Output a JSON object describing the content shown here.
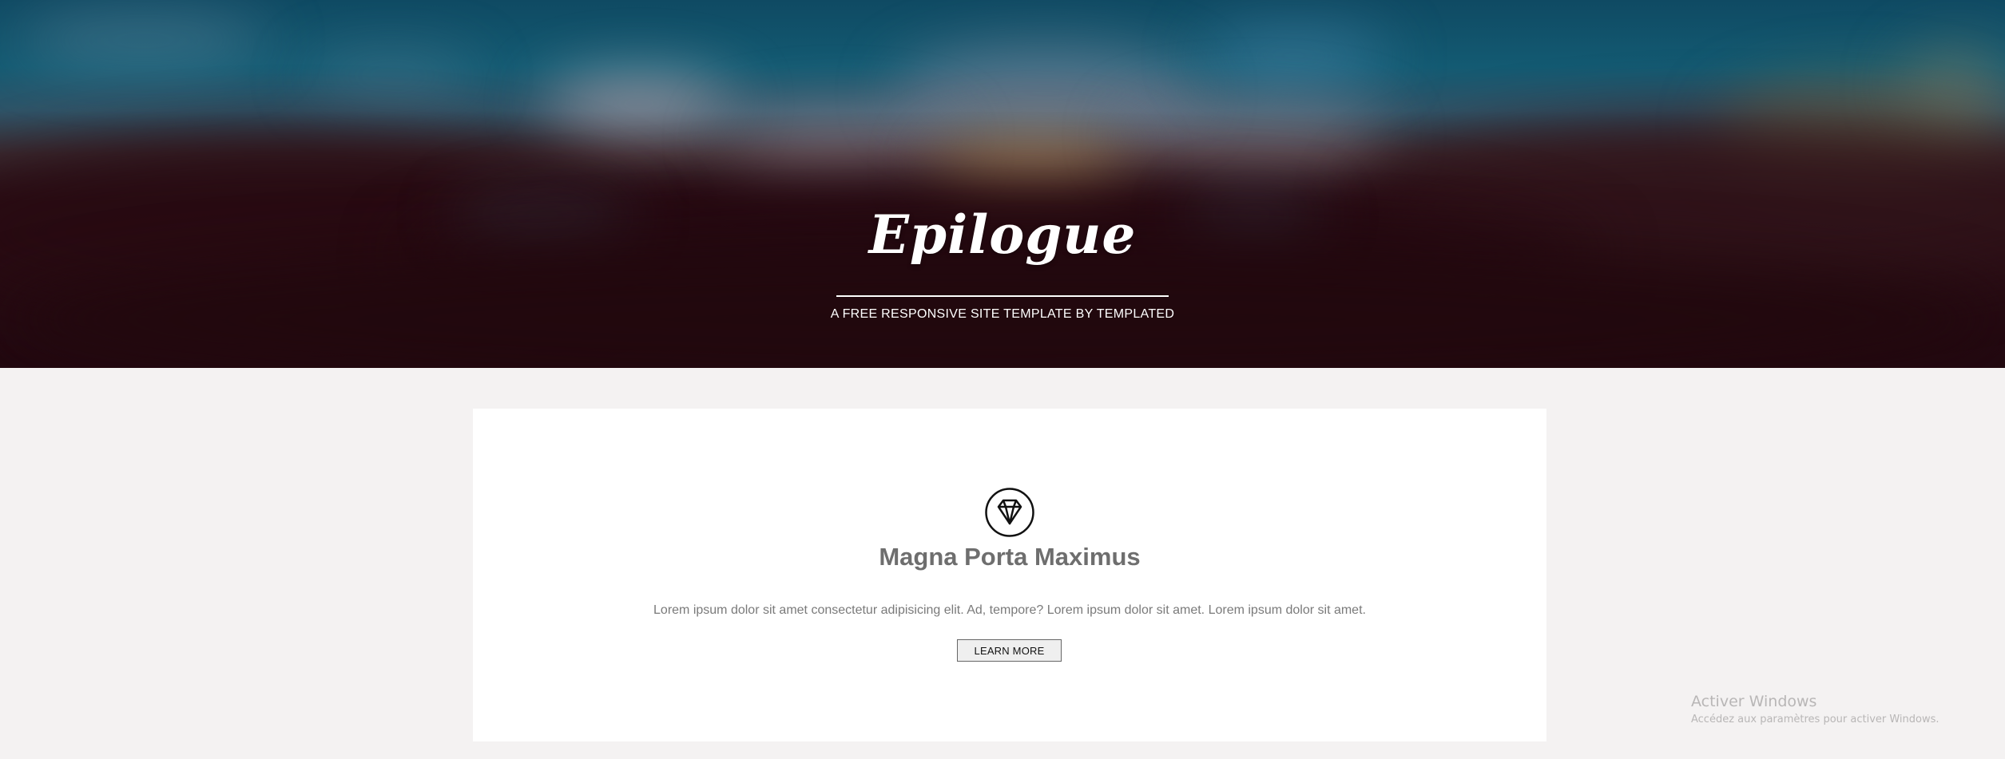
{
  "banner": {
    "brand": "Epilogue",
    "tagline": "A FREE RESPONSIVE SITE TEMPLATE BY TEMPLATED"
  },
  "feature": {
    "icon": "diamond-icon",
    "title": "Magna Porta Maximus",
    "text": "Lorem ipsum dolor sit amet consectetur adipisicing elit. Ad, tempore? Lorem ipsum dolor sit amet. Lorem ipsum dolor sit amet.",
    "button_label": "LEARN MORE"
  },
  "watermark": {
    "title": "Activer Windows",
    "subtitle": "Accédez aux paramètres pour activer Windows."
  },
  "colors": {
    "page_background": "#f4f2f2",
    "card_background": "#ffffff",
    "banner_dark": "#220810",
    "banner_sky": "#135a72",
    "title_gray": "#6e6e6e"
  }
}
